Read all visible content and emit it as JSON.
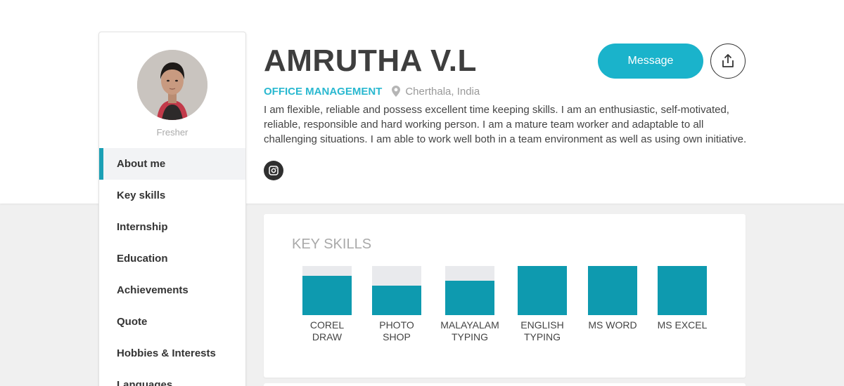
{
  "profile": {
    "name": "AMRUTHA V.L",
    "job_title": "OFFICE MANAGEMENT",
    "location": "Cherthala, India",
    "status": "Fresher",
    "bio": "I am flexible, reliable and possess excellent time keeping skills. I am an enthusiastic, self-motivated, reliable, responsible and hard working person. I am a mature team worker and adaptable to all challenging situations. I am able to work well both in a team environment as well as using own initiative.",
    "social": [
      "instagram-icon"
    ]
  },
  "actions": {
    "message_label": "Message",
    "share_icon": "share-icon"
  },
  "sidebar": {
    "active": "About me",
    "items": [
      {
        "label": "About me"
      },
      {
        "label": "Key skills"
      },
      {
        "label": "Internship"
      },
      {
        "label": "Education"
      },
      {
        "label": "Achievements"
      },
      {
        "label": "Quote"
      },
      {
        "label": "Hobbies & Interests"
      },
      {
        "label": "Languages"
      }
    ]
  },
  "skills_section": {
    "title": "KEY SKILLS",
    "items": [
      {
        "label": "COREL\nDRAW",
        "level": 0.8
      },
      {
        "label": "PHOTO\nSHOP",
        "level": 0.6
      },
      {
        "label": "MALAYALAM\nTYPING",
        "level": 0.7
      },
      {
        "label": "ENGLISH\nTYPING",
        "level": 1.0
      },
      {
        "label": "MS WORD",
        "level": 1.0
      },
      {
        "label": "MS EXCEL",
        "level": 1.0
      }
    ]
  },
  "colors": {
    "accent": "#1ab3cb",
    "skill_fill": "#0e9aaf",
    "skill_track": "#e9eaed",
    "active_marker": "#1ba0b5"
  }
}
